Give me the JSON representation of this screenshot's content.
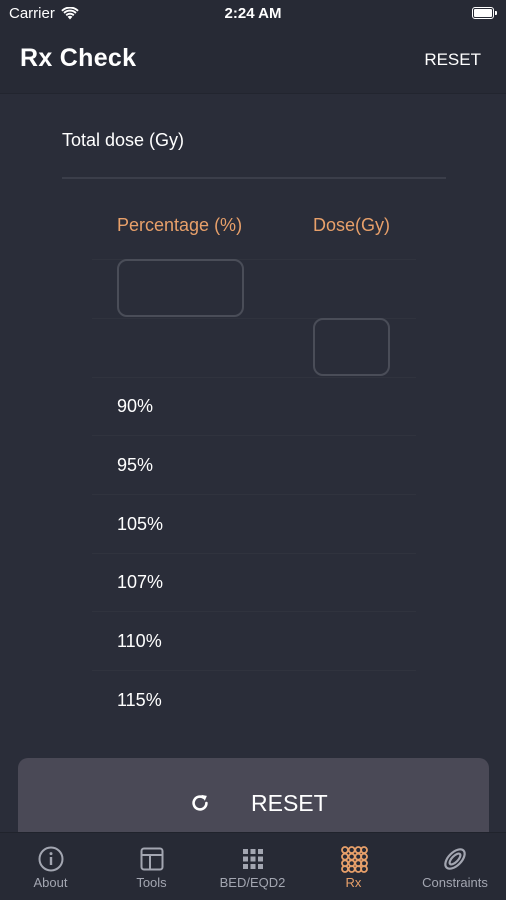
{
  "status": {
    "carrier": "Carrier",
    "time": "2:24 AM"
  },
  "nav": {
    "title": "Rx Check",
    "reset_label": "RESET"
  },
  "form": {
    "total_dose_label": "Total dose (Gy)",
    "percentage_header": "Percentage (%)",
    "dose_header": "Dose(Gy)",
    "percentage_value": "",
    "dose_value": ""
  },
  "percentages": [
    "90%",
    "95%",
    "105%",
    "107%",
    "110%",
    "115%"
  ],
  "reset_button": {
    "label": "RESET"
  },
  "tabs": [
    {
      "label": "About",
      "icon": "info-circle-icon"
    },
    {
      "label": "Tools",
      "icon": "tools-grid-icon"
    },
    {
      "label": "BED/EQD2",
      "icon": "dot-grid-icon"
    },
    {
      "label": "Rx",
      "icon": "rx-circles-icon"
    },
    {
      "label": "Constraints",
      "icon": "rings-icon"
    }
  ],
  "colors": {
    "accent": "#e8a06a",
    "background": "#2a2d39",
    "bar": "#272a35",
    "button": "#4a4956"
  }
}
